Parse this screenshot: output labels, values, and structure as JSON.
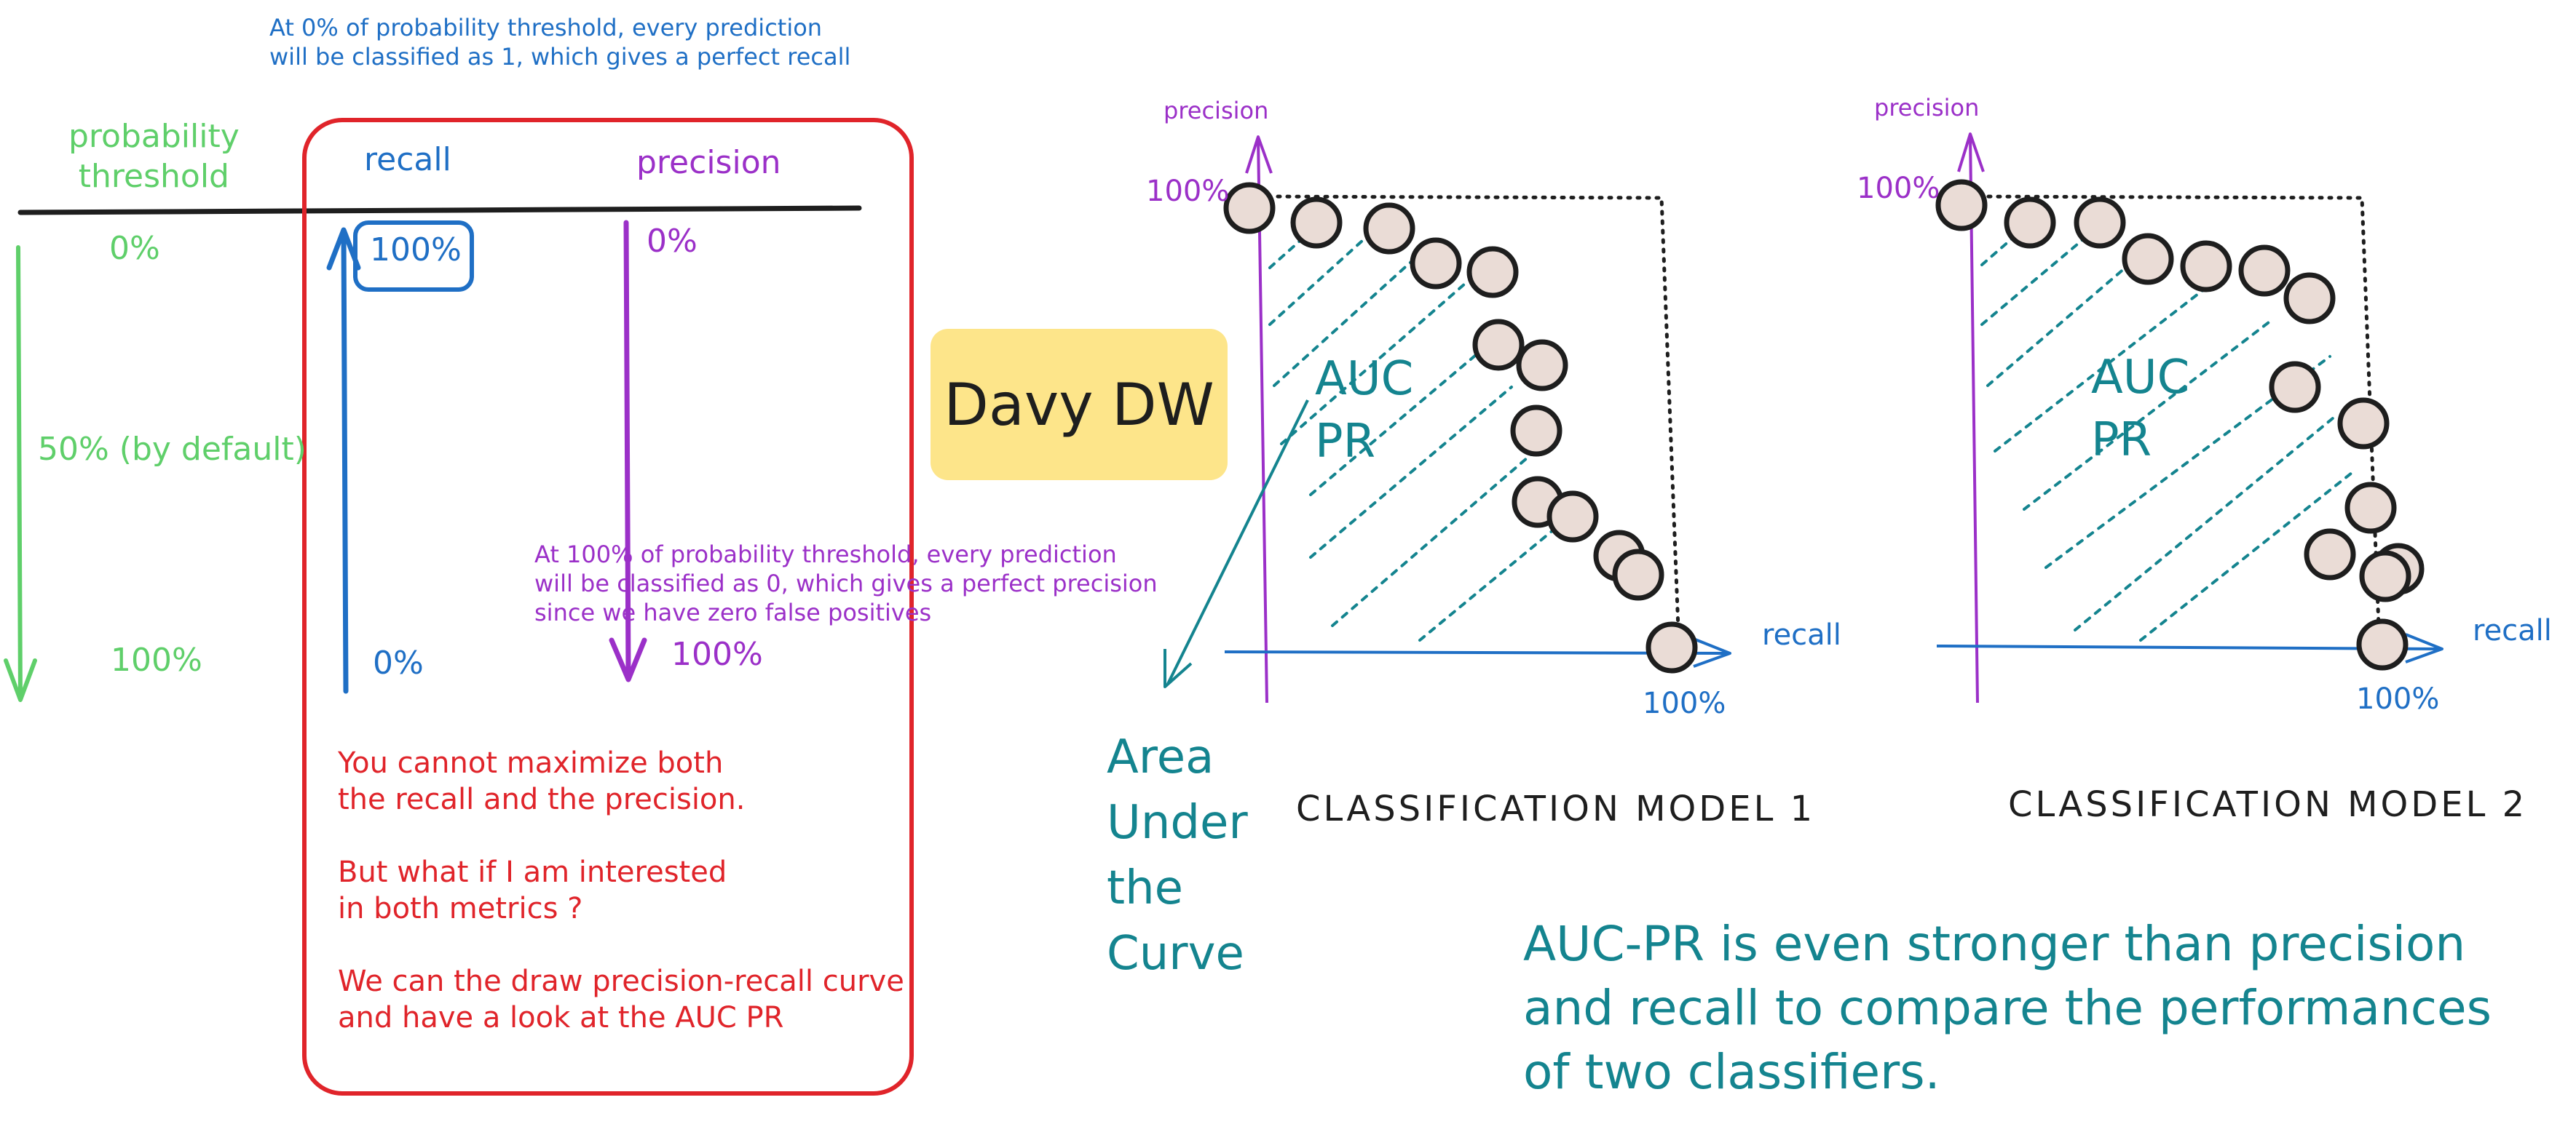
{
  "top_note": [
    "At 0% of probability threshold, every prediction",
    "will be classified as 1, which gives a perfect recall"
  ],
  "table": {
    "threshold_header": [
      "probability",
      "threshold"
    ],
    "recall_header": "recall",
    "precision_header": "precision",
    "threshold_values": [
      "0%",
      "50% (by default)",
      "100%"
    ],
    "recall_values": [
      "100%",
      "0%"
    ],
    "precision_values": [
      "0%",
      "100%"
    ]
  },
  "mid_note": [
    "At 100% of probability threshold, every prediction",
    "will be classified as 0, which gives a perfect precision",
    "since we have zero false positives"
  ],
  "red_note": [
    "You cannot maximize both",
    "the recall and the precision.",
    "",
    "But what if I am interested",
    "in both metrics ?",
    "",
    "We can the draw precision-recall curve",
    "and have a look at the AUC PR"
  ],
  "logo_text": "Davy DW",
  "models": [
    {
      "title": "CLASSIFICATION MODEL 1",
      "y_label": "precision",
      "x_label": "recall",
      "y_tick": "100%",
      "x_tick": "100%",
      "area_label": [
        "AUC",
        "PR"
      ]
    },
    {
      "title": "CLASSIFICATION MODEL 2",
      "y_label": "precision",
      "x_label": "recall",
      "y_tick": "100%",
      "x_tick": "100%",
      "area_label": [
        "AUC",
        "PR"
      ]
    }
  ],
  "area_annotation": [
    "Area",
    "Under",
    "the",
    "Curve"
  ],
  "conclusion": [
    "AUC-PR is even stronger than precision",
    "and recall to compare the performances",
    "of two classifiers."
  ],
  "colors": {
    "green": "#5fcf6a",
    "blue": "#1f6fc5",
    "purple": "#9b30c8",
    "red": "#e0242a",
    "teal": "#14848f",
    "point_fill": "#eadcd6",
    "logo_bg": "#fde58a"
  }
}
